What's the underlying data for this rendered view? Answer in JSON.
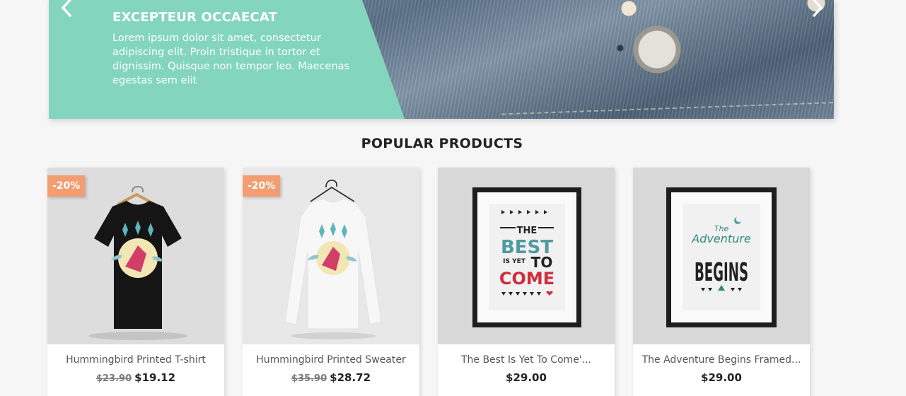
{
  "hero": {
    "title": "EXCEPTEUR OCCAECAT",
    "text": "Lorem ipsum dolor sit amet, consectetur adipiscing elit. Proin tristique in tortor et dignissim. Quisque non tempor leo. Maecenas egestas sem elit",
    "colors": {
      "panel": "#83d6bd"
    }
  },
  "section": {
    "title": "POPULAR PRODUCTS"
  },
  "products": [
    {
      "name": "Hummingbird Printed T-shirt",
      "old_price": "$23.90",
      "price": "$19.12",
      "badge": "-20%",
      "image": "black-tshirt-image"
    },
    {
      "name": "Hummingbird Printed Sweater",
      "old_price": "$35.90",
      "price": "$28.72",
      "badge": "-20%",
      "image": "white-sweater-image"
    },
    {
      "name": "The Best Is Yet To Come'...",
      "price": "$29.00",
      "image": "framed-poster-best-is-yet-to-come",
      "poster": {
        "line1": "THE",
        "line2": "BEST",
        "line3": "IS YET",
        "line4": "TO",
        "line5": "COME"
      }
    },
    {
      "name": "The Adventure Begins Framed...",
      "price": "$29.00",
      "image": "framed-poster-adventure-begins",
      "poster": {
        "line1": "The",
        "line2": "Adventure",
        "line3": "BEGINS"
      }
    }
  ],
  "colors": {
    "badge": "#f39d72",
    "background": "#f6f6f6",
    "text": "#232323"
  }
}
